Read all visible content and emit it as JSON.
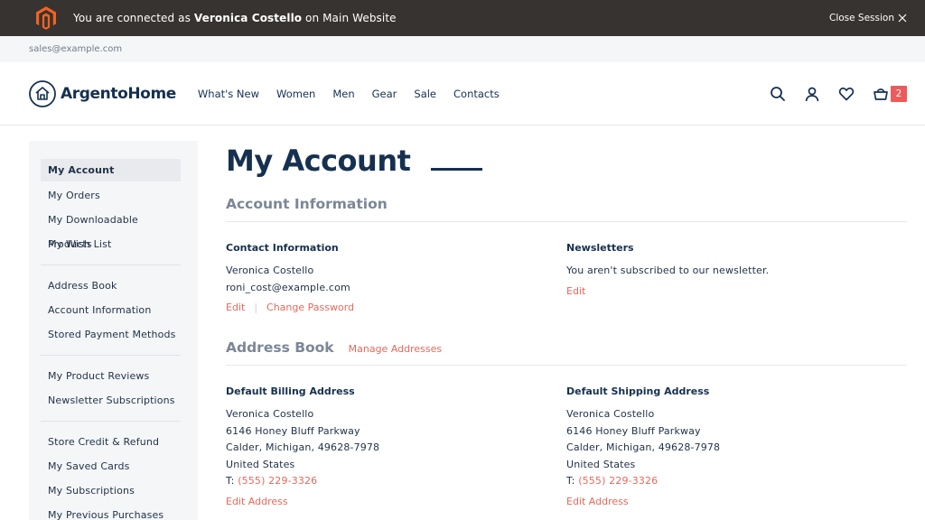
{
  "session": {
    "prefix": "You are connected as",
    "user": "Veronica Costello",
    "suffix": "on Main Website",
    "close_label": "Close Session"
  },
  "topline": {
    "email": "sales@example.com"
  },
  "brand": {
    "name": "ArgentoHome"
  },
  "nav": [
    "What's New",
    "Women",
    "Men",
    "Gear",
    "Sale",
    "Contacts"
  ],
  "cart": {
    "count": "2"
  },
  "icons": {
    "search": "search-icon",
    "account": "user-icon",
    "wishlist": "heart-icon",
    "cart": "basket-icon"
  },
  "colors": {
    "accent": "#e8685a",
    "brand": "#163050",
    "badge": "#ee5a5a"
  },
  "sidebar": {
    "groups": [
      [
        "My Account",
        "My Orders",
        "My Downloadable Products",
        "My Wish List"
      ],
      [
        "Address Book",
        "Account Information",
        "Stored Payment Methods"
      ],
      [
        "My Product Reviews",
        "Newsletter Subscriptions"
      ],
      [
        "Store Credit & Refund",
        "My Saved Cards",
        "My Subscriptions",
        "My Previous Purchases"
      ]
    ]
  },
  "page": {
    "title": "My Account"
  },
  "account_info": {
    "title": "Account Information",
    "contact": {
      "title": "Contact Information",
      "name": "Veronica Costello",
      "email": "roni_cost@example.com",
      "edit": "Edit",
      "separator": "|",
      "change_password": "Change Password"
    },
    "newsletters": {
      "title": "Newsletters",
      "text": "You aren't subscribed to our newsletter.",
      "edit": "Edit"
    }
  },
  "address_book": {
    "title": "Address Book",
    "manage": "Manage Addresses",
    "billing": {
      "title": "Default Billing Address",
      "name": "Veronica Costello",
      "street": "6146 Honey Bluff Parkway",
      "city": "Calder, Michigan, 49628-7978",
      "country": "United States",
      "phone_prefix": "T:",
      "phone": "(555) 229-3326",
      "edit": "Edit Address"
    },
    "shipping": {
      "title": "Default Shipping Address",
      "name": "Veronica Costello",
      "street": "6146 Honey Bluff Parkway",
      "city": "Calder, Michigan, 49628-7978",
      "country": "United States",
      "phone_prefix": "T:",
      "phone": "(555) 229-3326",
      "edit": "Edit Address"
    }
  }
}
